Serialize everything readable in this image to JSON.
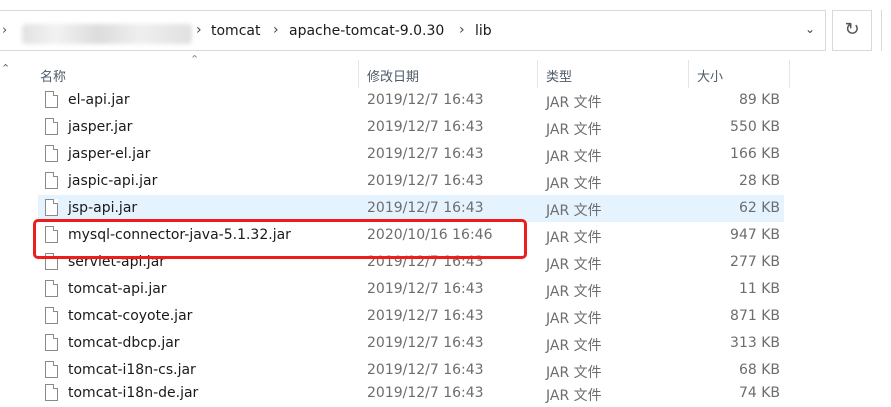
{
  "address_bar": {
    "breadcrumbs": [
      "tomcat",
      "apache-tomcat-9.0.30",
      "lib"
    ]
  },
  "columns": {
    "name": "名称",
    "date": "修改日期",
    "type": "类型",
    "size": "大小"
  },
  "files": [
    {
      "name": "el-api.jar",
      "date": "2019/12/7 16:43",
      "type": "JAR 文件",
      "size": "89 KB"
    },
    {
      "name": "jasper.jar",
      "date": "2019/12/7 16:43",
      "type": "JAR 文件",
      "size": "550 KB"
    },
    {
      "name": "jasper-el.jar",
      "date": "2019/12/7 16:43",
      "type": "JAR 文件",
      "size": "166 KB"
    },
    {
      "name": "jaspic-api.jar",
      "date": "2019/12/7 16:43",
      "type": "JAR 文件",
      "size": "28 KB"
    },
    {
      "name": "jsp-api.jar",
      "date": "2019/12/7 16:43",
      "type": "JAR 文件",
      "size": "62 KB"
    },
    {
      "name": "mysql-connector-java-5.1.32.jar",
      "date": "2020/10/16 16:46",
      "type": "JAR 文件",
      "size": "947 KB"
    },
    {
      "name": "servlet-api.jar",
      "date": "2019/12/7 16:43",
      "type": "JAR 文件",
      "size": "277 KB"
    },
    {
      "name": "tomcat-api.jar",
      "date": "2019/12/7 16:43",
      "type": "JAR 文件",
      "size": "11 KB"
    },
    {
      "name": "tomcat-coyote.jar",
      "date": "2019/12/7 16:43",
      "type": "JAR 文件",
      "size": "871 KB"
    },
    {
      "name": "tomcat-dbcp.jar",
      "date": "2019/12/7 16:43",
      "type": "JAR 文件",
      "size": "313 KB"
    },
    {
      "name": "tomcat-i18n-cs.jar",
      "date": "2019/12/7 16:43",
      "type": "JAR 文件",
      "size": "68 KB"
    },
    {
      "name": "tomcat-i18n-de.jar",
      "date": "2019/12/7 16:43",
      "type": "JAR 文件",
      "size": "74 KB"
    }
  ],
  "selected_file": "jsp-api.jar",
  "highlighted_file": "mysql-connector-java-5.1.32.jar",
  "colors": {
    "selection": "#e5f3ff",
    "highlight_border": "#ee1c1c",
    "header_text": "#4d5b6b"
  },
  "icons": {
    "refresh": "refresh-icon",
    "dropdown": "chevron-down-icon",
    "breadcrumb_separator": "chevron-right-icon",
    "file": "file-icon"
  }
}
